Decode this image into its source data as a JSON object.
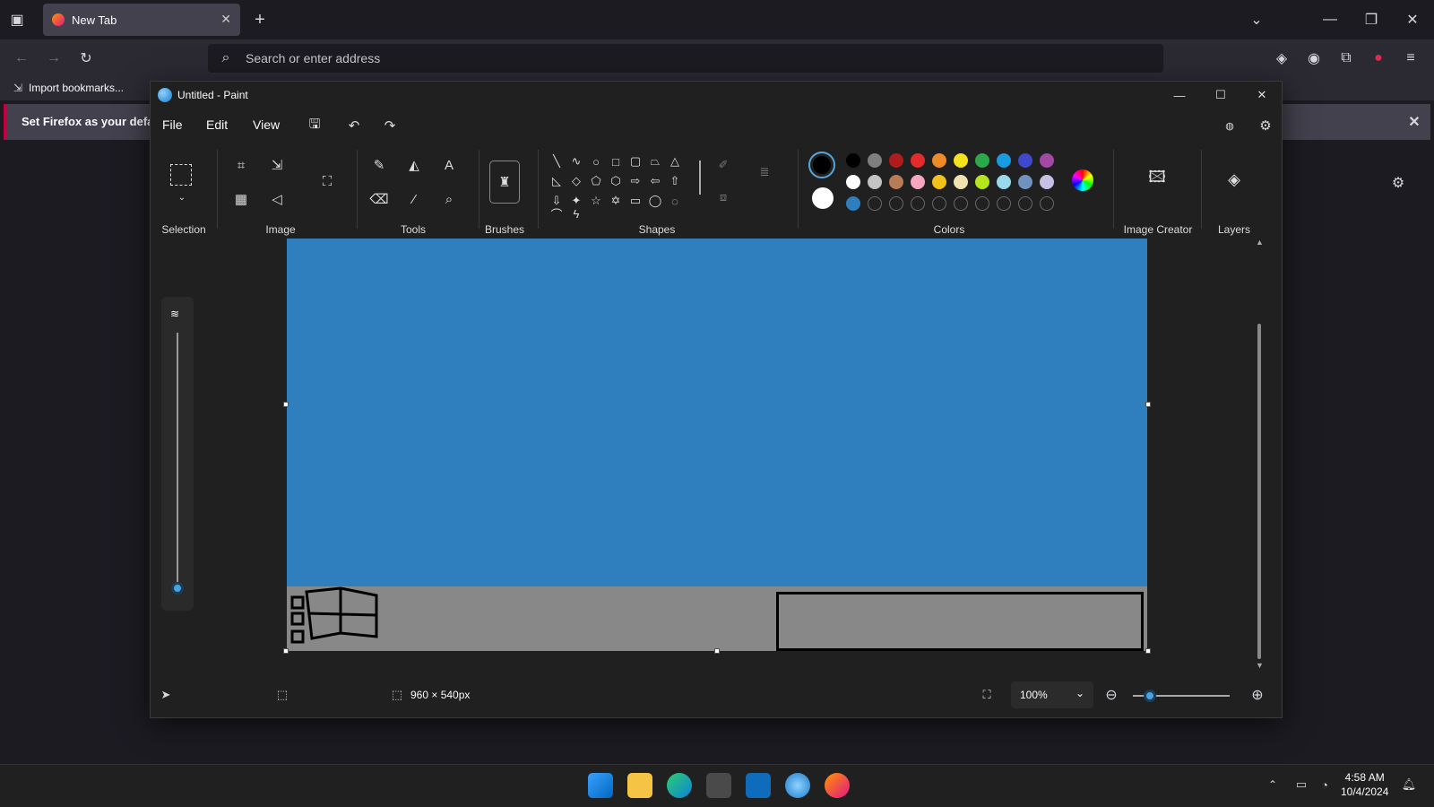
{
  "browser": {
    "tab_title": "New Tab",
    "url_placeholder": "Search or enter address",
    "bookmark_import": "Import bookmarks...",
    "notification": "Set Firefox as your default"
  },
  "paint": {
    "window_title": "Untitled - Paint",
    "menu": [
      "File",
      "Edit",
      "View"
    ],
    "groups": {
      "selection": "Selection",
      "image": "Image",
      "tools": "Tools",
      "brushes": "Brushes",
      "shapes": "Shapes",
      "colors": "Colors",
      "image_creator": "Image Creator",
      "layers": "Layers"
    },
    "status": {
      "canvas_size": "960 × 540px",
      "zoom": "100%"
    },
    "palette_row1": [
      "#000000",
      "#7f7f7f",
      "#b01c1c",
      "#e52b2b",
      "#ef8a28",
      "#f4e21c",
      "#2aa84a",
      "#199be0",
      "#3f48cc",
      "#a349a4"
    ],
    "palette_row2": [
      "#ffffff",
      "#c3c3c3",
      "#b97a57",
      "#f7a6c2",
      "#f3c11c",
      "#efe4b0",
      "#b5e61d",
      "#99d9ea",
      "#7092be",
      "#c8bfe7"
    ],
    "palette_row3_first": "#2f7fbf",
    "primary_color": "#000000",
    "secondary_color": "#ffffff",
    "canvas_sky_color": "#2f7fbf",
    "canvas_ground_color": "#888888"
  },
  "taskbar": {
    "time": "4:58 AM",
    "date": "10/4/2024"
  }
}
